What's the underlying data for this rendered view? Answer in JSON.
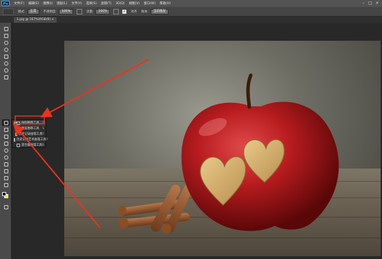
{
  "menubar": {
    "logo": "Ps",
    "items": [
      "文件(F)",
      "编辑(E)",
      "图像(I)",
      "图层(L)",
      "文字(Y)",
      "选择(S)",
      "滤镜(T)",
      "3D(D)",
      "视图(V)",
      "窗口(W)",
      "帮助(H)"
    ],
    "window_controls": [
      "–",
      "□",
      "×"
    ]
  },
  "options": {
    "mode_label": "模式:",
    "mode_value": "正常",
    "opacity_label": "不透明度:",
    "opacity_value": "100%",
    "flow_label": "流量:",
    "flow_value": "100%",
    "align_label": "对齐",
    "sample_label": "样本:",
    "sample_value": "当前图层"
  },
  "document": {
    "tab_label": "1.jpg @ 167%(RGB/8) ×"
  },
  "flyout": {
    "items": [
      {
        "label": "仿制图章工具",
        "key": "S"
      },
      {
        "label": "图案图章工具",
        "key": "S"
      },
      {
        "label": "历史记录画笔工具",
        "key": "Y"
      },
      {
        "label": "历史记录艺术画笔工具",
        "key": "Y"
      },
      {
        "label": "混合器画笔工具",
        "key": "B"
      }
    ]
  },
  "colors": {
    "accent": "#31a8ff",
    "arrow": "#e8331f",
    "foreground_swatch": "#111111",
    "background_swatch": "#e8e31a"
  }
}
